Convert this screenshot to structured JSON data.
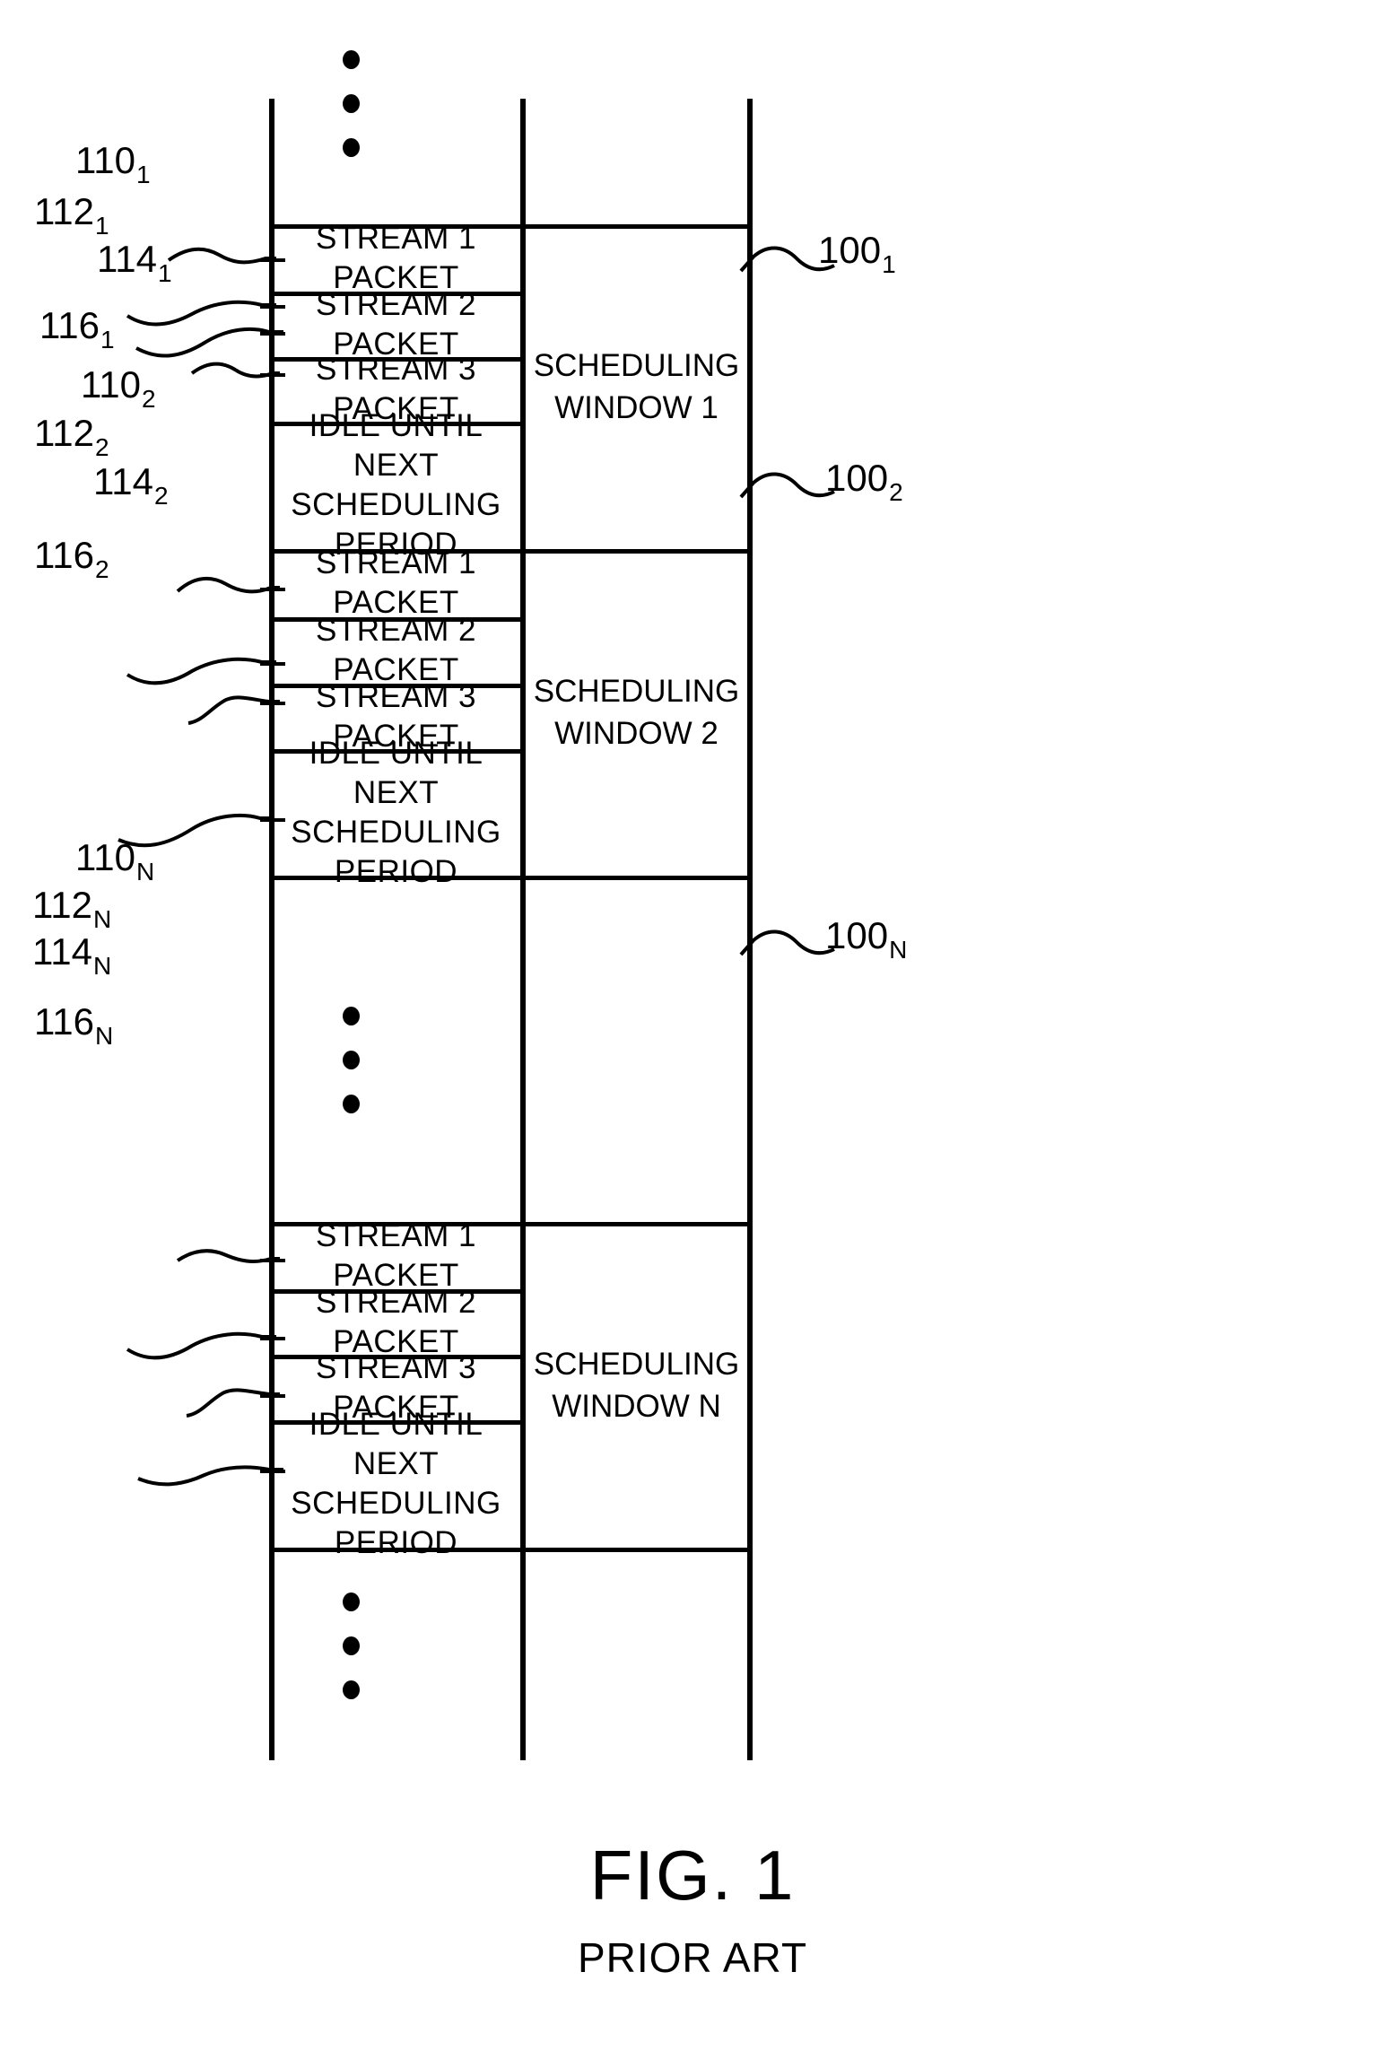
{
  "figure": {
    "title": "FIG. 1",
    "subtitle": "PRIOR ART"
  },
  "labels": {
    "stream1": "STREAM 1 PACKET",
    "stream2": "STREAM 2 PACKET",
    "stream3": "STREAM 3 PACKET",
    "idle_line1": "IDLE UNTIL NEXT",
    "idle_line2": "SCHEDULING PERIOD",
    "idle": "IDLE UNTIL NEXT\nSCHEDULING PERIOD"
  },
  "windows": [
    {
      "key": "w1",
      "window_label": "SCHEDULING\nWINDOW 1",
      "window_ref_num": "100",
      "window_ref_sub": "1",
      "rows": [
        {
          "text": "STREAM 1 PACKET",
          "ref_num": "110",
          "ref_sub": "1"
        },
        {
          "text": "STREAM 2 PACKET",
          "ref_num": "112",
          "ref_sub": "1"
        },
        {
          "text": "STREAM 3 PACKET",
          "ref_num": "114",
          "ref_sub": "1"
        },
        {
          "text": "IDLE UNTIL NEXT\nSCHEDULING PERIOD",
          "ref_num": "116",
          "ref_sub": "1"
        }
      ]
    },
    {
      "key": "w2",
      "window_label": "SCHEDULING\nWINDOW 2",
      "window_ref_num": "100",
      "window_ref_sub": "2",
      "rows": [
        {
          "text": "STREAM 1 PACKET",
          "ref_num": "110",
          "ref_sub": "2"
        },
        {
          "text": "STREAM 2 PACKET",
          "ref_num": "112",
          "ref_sub": "2"
        },
        {
          "text": "STREAM 3 PACKET",
          "ref_num": "114",
          "ref_sub": "2"
        },
        {
          "text": "IDLE UNTIL NEXT\nSCHEDULING PERIOD",
          "ref_num": "116",
          "ref_sub": "2"
        }
      ]
    },
    {
      "key": "wN",
      "window_label": "SCHEDULING\nWINDOW N",
      "window_ref_num": "100",
      "window_ref_sub": "N",
      "rows": [
        {
          "text": "STREAM 1 PACKET",
          "ref_num": "110",
          "ref_sub": "N"
        },
        {
          "text": "STREAM 2 PACKET",
          "ref_num": "112",
          "ref_sub": "N"
        },
        {
          "text": "STREAM 3 PACKET",
          "ref_num": "114",
          "ref_sub": "N"
        },
        {
          "text": "IDLE UNTIL NEXT\nSCHEDULING PERIOD",
          "ref_num": "116",
          "ref_sub": "N"
        }
      ]
    }
  ],
  "ellipses": [
    {
      "name": "top-ellipsis"
    },
    {
      "name": "middle-ellipsis"
    },
    {
      "name": "bottom-ellipsis"
    }
  ]
}
